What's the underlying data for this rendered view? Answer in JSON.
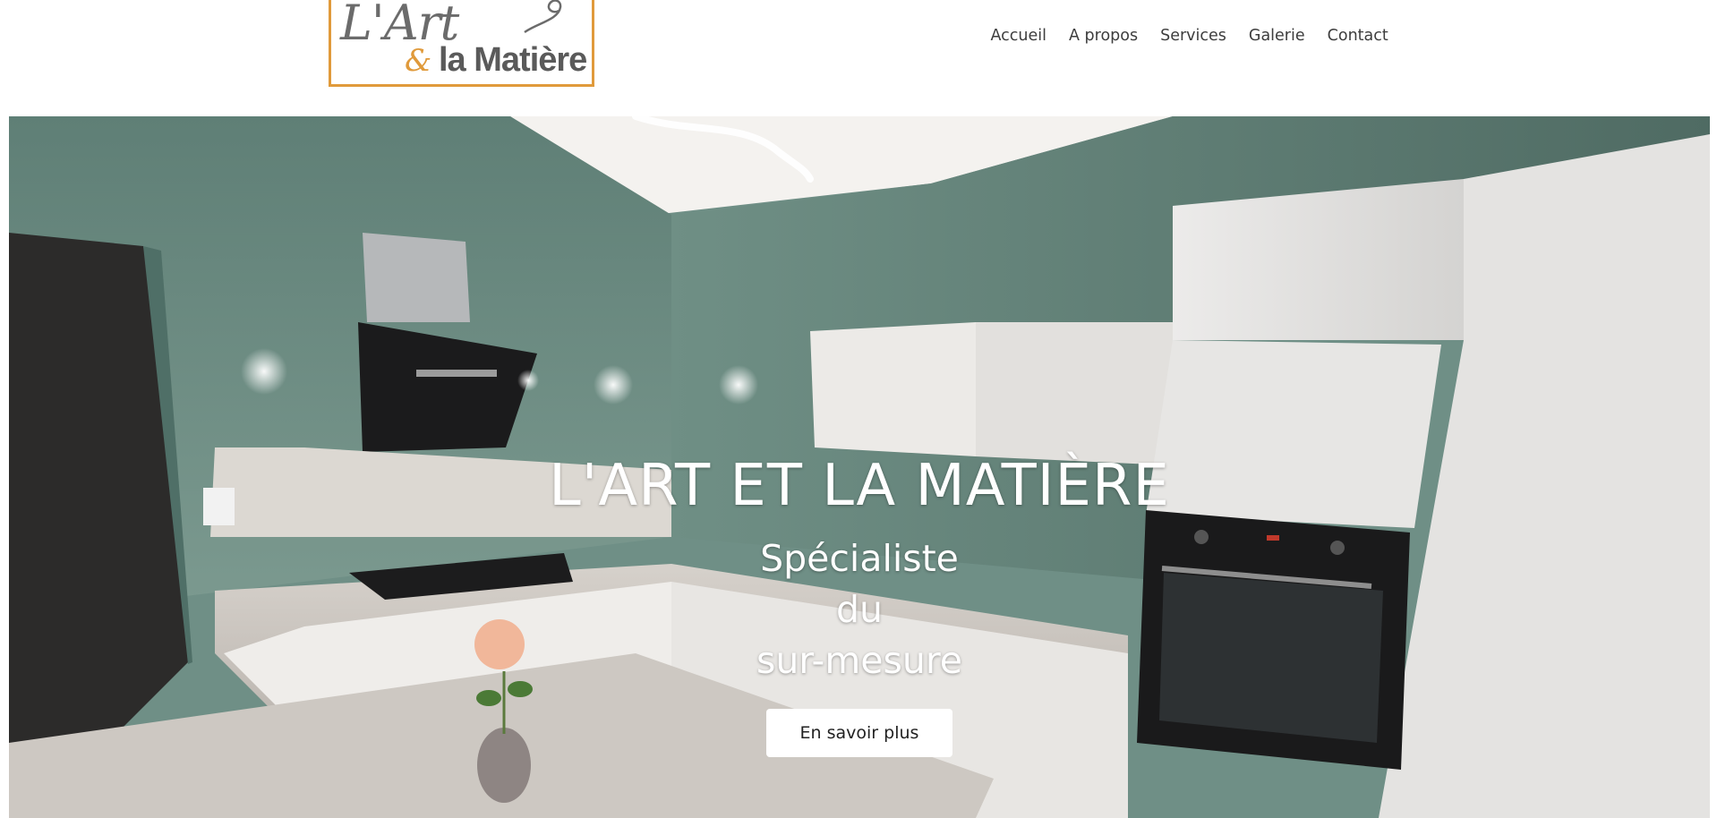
{
  "header": {
    "logo": {
      "text_line1": "L'Art",
      "ampersand": "&",
      "text_line2": "la Matière",
      "accent_color": "#e09a3b",
      "text_color": "#5a5a5a"
    },
    "nav": [
      {
        "label": "Accueil"
      },
      {
        "label": "A propos"
      },
      {
        "label": "Services"
      },
      {
        "label": "Galerie"
      },
      {
        "label": "Contact"
      }
    ]
  },
  "hero": {
    "title": "L'ART ET LA MATIÈRE",
    "subtitle_lines": [
      "Spécialiste",
      "du",
      "sur-mesure"
    ],
    "cta_label": "En savoir plus",
    "background_description_icon": "kitchen-photo",
    "colors": {
      "wall": "#6f8f86",
      "cabinets": "#e9e7e4",
      "text": "#ffffff"
    }
  }
}
